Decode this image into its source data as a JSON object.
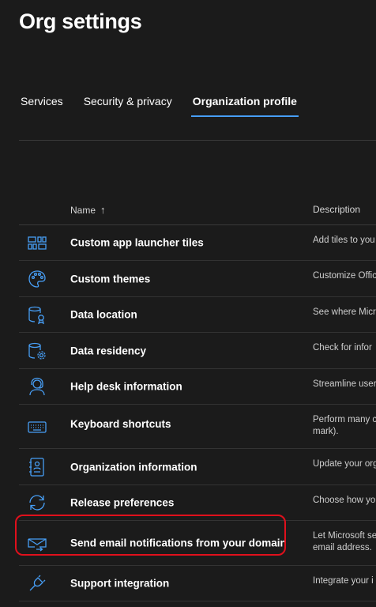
{
  "page": {
    "title": "Org settings"
  },
  "tabs": [
    {
      "label": "Services",
      "active": false
    },
    {
      "label": "Security & privacy",
      "active": false
    },
    {
      "label": "Organization profile",
      "active": true
    }
  ],
  "table": {
    "columns": {
      "name": "Name",
      "name_sort": "↑",
      "description": "Description"
    },
    "rows": [
      {
        "name": "Custom app launcher tiles",
        "description": "Add tiles to you",
        "icon": "app-tiles-icon"
      },
      {
        "name": "Custom themes",
        "description": "Customize Offic",
        "icon": "palette-icon"
      },
      {
        "name": "Data location",
        "description": "See where Micr",
        "icon": "database-location-icon"
      },
      {
        "name": "Data residency",
        "description": "Check for infor",
        "icon": "database-settings-icon"
      },
      {
        "name": "Help desk information",
        "description": "Streamline user",
        "icon": "headset-person-icon"
      },
      {
        "name": "Keyboard shortcuts",
        "description": "Perform many c\nmark).",
        "icon": "keyboard-icon"
      },
      {
        "name": "Organization information",
        "description": "Update your org",
        "icon": "contact-card-icon"
      },
      {
        "name": "Release preferences",
        "description": "Choose how yo",
        "icon": "sync-arrows-icon"
      },
      {
        "name": "Send email notifications from your domain",
        "description": "Let Microsoft se\nemail address.",
        "icon": "mail-send-icon"
      },
      {
        "name": "Support integration",
        "description": "Integrate your i",
        "icon": "plug-icon"
      }
    ]
  },
  "colors": {
    "background": "#1b1b1b",
    "accent": "#479ef5",
    "icon": "#479ef5",
    "highlight": "#e0101c"
  }
}
